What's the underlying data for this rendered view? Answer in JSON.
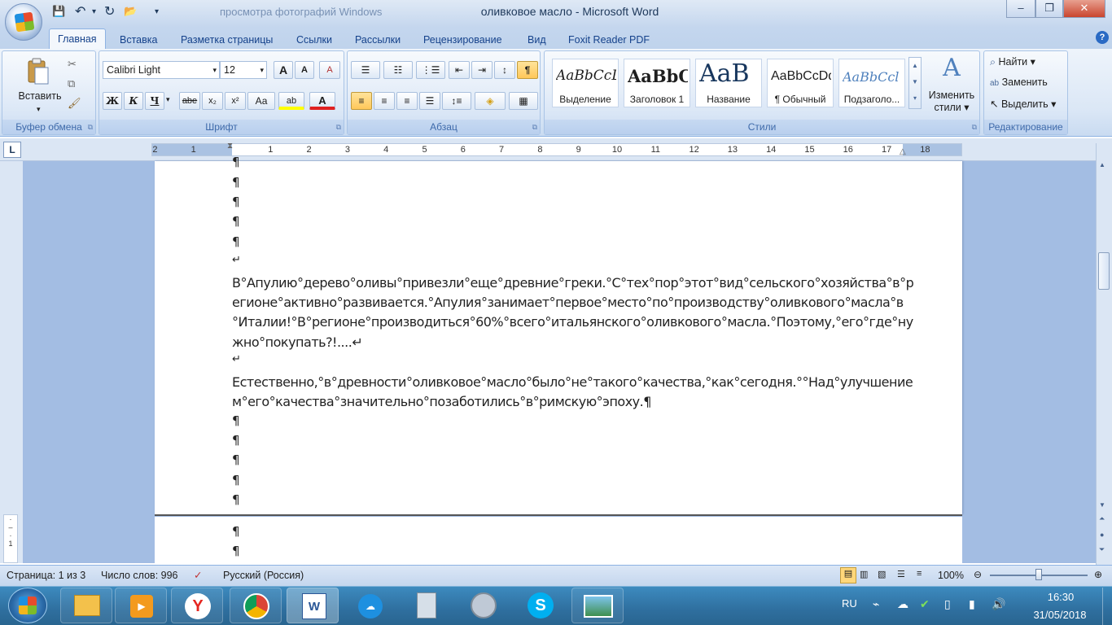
{
  "window": {
    "title": "оливковое масло - Microsoft Word",
    "bg_title": "просмотра фотографий Windows",
    "min": "–",
    "restore": "❐",
    "close": "✕"
  },
  "qat": {
    "save": "💾",
    "undo": "↶",
    "redo": "↻",
    "open": "📂",
    "more": "▾"
  },
  "tabs": [
    "Главная",
    "Вставка",
    "Разметка страницы",
    "Ссылки",
    "Рассылки",
    "Рецензирование",
    "Вид",
    "Foxit Reader PDF"
  ],
  "help": "?",
  "clipboard": {
    "paste": "Вставить",
    "label": "Буфер обмена"
  },
  "font": {
    "name": "Calibri Light",
    "size": "12",
    "label": "Шрифт",
    "bold": "Ж",
    "italic": "К",
    "underline": "Ч",
    "strike": "abe",
    "sub": "x₂",
    "sup": "x²",
    "case": "Аа",
    "grow": "A",
    "shrink": "A",
    "clear": "A",
    "highlight": "ab",
    "color": "A"
  },
  "paragraph": {
    "label": "Абзац",
    "pilcrow": "¶"
  },
  "styles": {
    "label": "Стили",
    "items": [
      {
        "sample": "AaBbCcL",
        "name": "Выделение"
      },
      {
        "sample": "AaBbC",
        "name": "Заголовок 1"
      },
      {
        "sample": "AaB",
        "name": "Название"
      },
      {
        "sample": "AaBbCcDd",
        "name": "¶ Обычный"
      },
      {
        "sample": "AaBbCcl",
        "name": "Подзаголо..."
      }
    ],
    "change_line1": "Изменить",
    "change_line2": "стили"
  },
  "editing": {
    "label": "Редактирование",
    "find": "Найти",
    "replace": "Заменить",
    "select": "Выделить"
  },
  "ruler": {
    "tab_selector": "L",
    "ticks_neg": [
      "2",
      "1"
    ],
    "ticks": [
      "1",
      "2",
      "3",
      "4",
      "5",
      "6",
      "7",
      "8",
      "9",
      "10",
      "11",
      "12",
      "13",
      "14",
      "15",
      "16",
      "17",
      "18"
    ]
  },
  "document": {
    "para_mark": "¶",
    "line_break": "↵",
    "p1": [
      "В°Апулию°дерево°оливы°привезли°еще°древние°греки.°С°тех°пор°этот°вид°сельского°хозяйства°в°р",
      "егионе°активно°развивается.°Апулия°занимает°первое°место°по°производству°оливкового°масла°в",
      "°Италии!°В°регионе°производиться°60%°всего°итальянского°оливкового°масла.°Поэтому,°его°где°ну",
      "жно°покупать?!....↵"
    ],
    "p2": [
      "Естественно,°в°древности°оливковое°масло°было°не°такого°качества,°как°сегодня.°°Над°улучшение",
      "м°его°качества°значительно°позаботились°в°римскую°эпоху.¶"
    ]
  },
  "status": {
    "page": "Страница: 1 из 3",
    "words": "Число слов: 996",
    "lang": "Русский (Россия)",
    "zoom": "100%",
    "zoom_level_pct": 100
  },
  "taskbar": {
    "lang": "RU",
    "time": "16:30",
    "date": "31/05/2018"
  }
}
